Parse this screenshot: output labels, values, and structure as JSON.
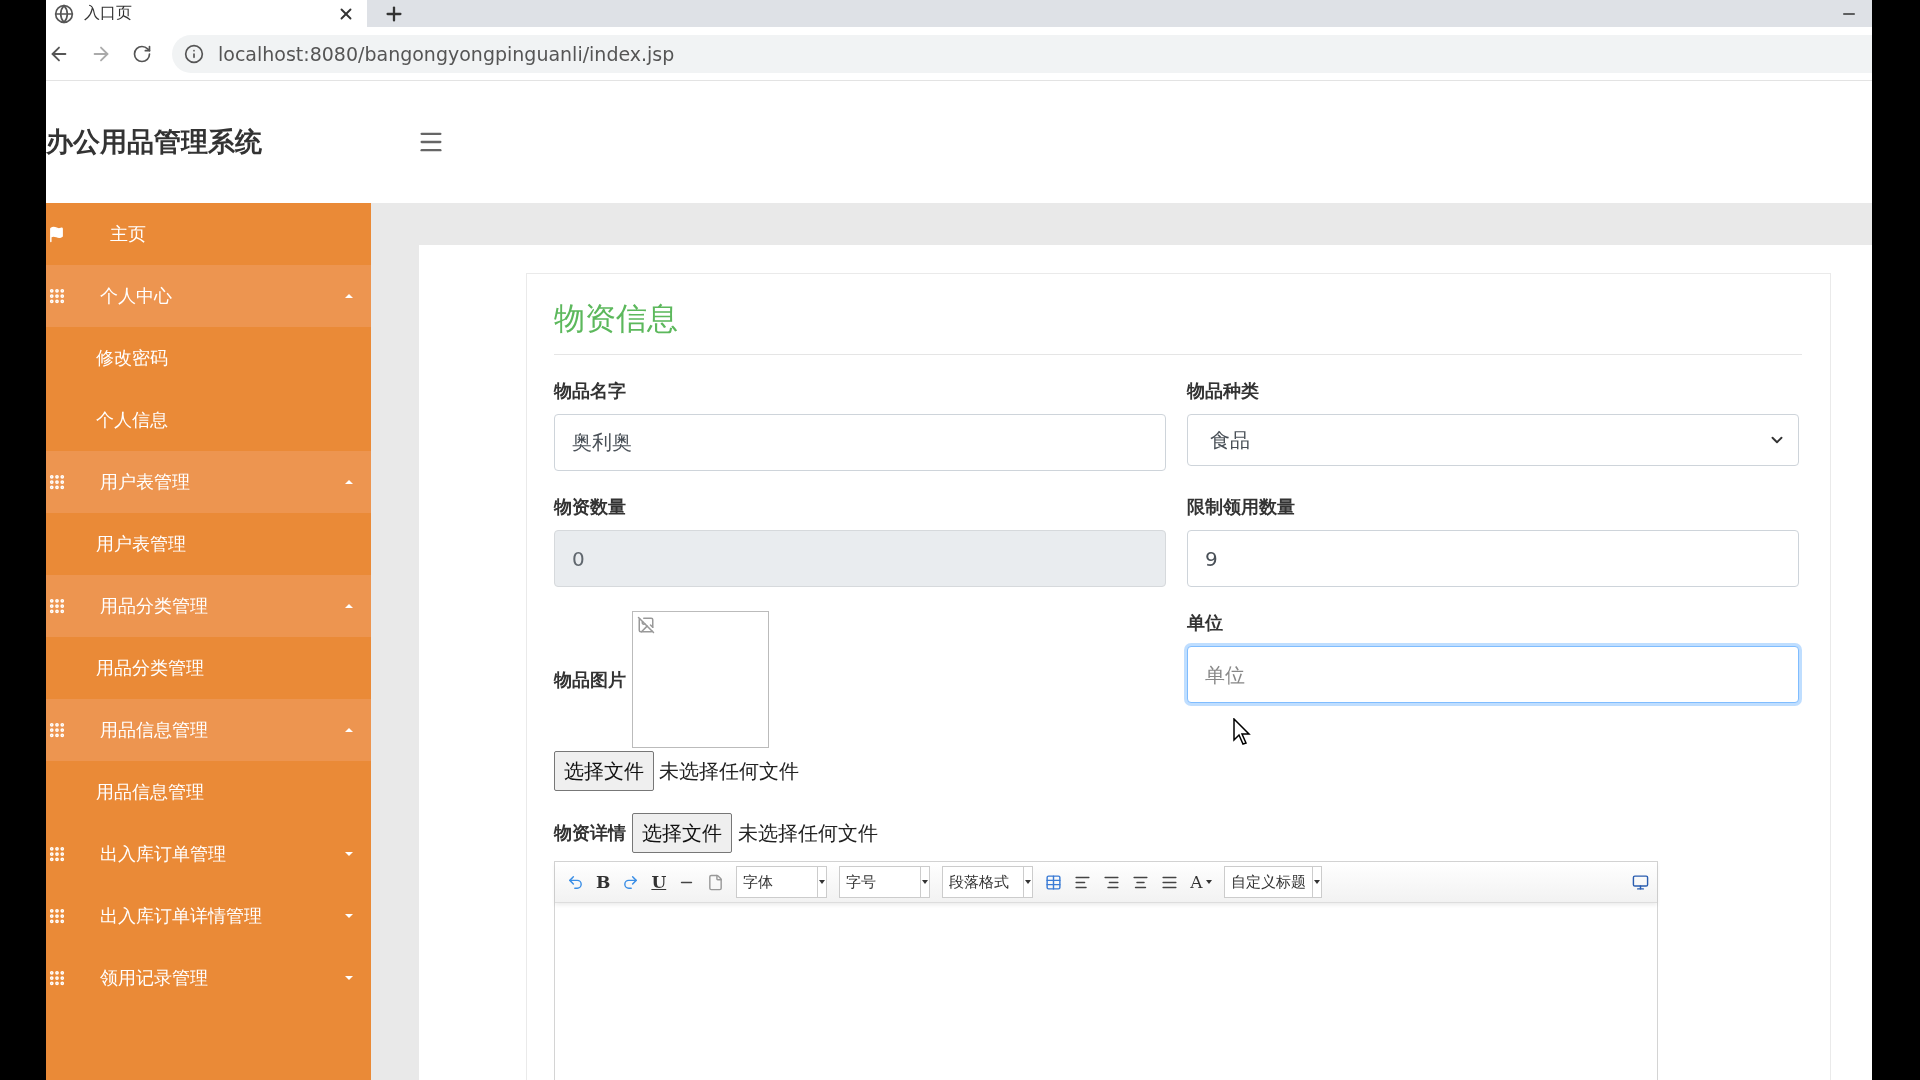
{
  "browser": {
    "tab_title": "入口页",
    "url": "localhost:8080/bangongyongpinguanli/index.jsp"
  },
  "header": {
    "title": "办公用品管理系统"
  },
  "sidebar": {
    "items": [
      {
        "kind": "link",
        "label": "主页"
      },
      {
        "kind": "group",
        "label": "个人中心",
        "expanded": true,
        "children": [
          {
            "label": "修改密码"
          },
          {
            "label": "个人信息"
          }
        ]
      },
      {
        "kind": "group",
        "label": "用户表管理",
        "expanded": true,
        "children": [
          {
            "label": "用户表管理"
          }
        ]
      },
      {
        "kind": "group",
        "label": "用品分类管理",
        "expanded": true,
        "children": [
          {
            "label": "用品分类管理"
          }
        ]
      },
      {
        "kind": "group",
        "label": "用品信息管理",
        "expanded": true,
        "children": [
          {
            "label": "用品信息管理"
          }
        ]
      },
      {
        "kind": "group",
        "label": "出入库订单管理",
        "expanded": false
      },
      {
        "kind": "group",
        "label": "出入库订单详情管理",
        "expanded": false
      },
      {
        "kind": "group",
        "label": "领用记录管理",
        "expanded": false
      }
    ]
  },
  "form": {
    "title": "物资信息",
    "fields": [
      {
        "kind": "text",
        "label": "物品名字",
        "value": "奥利奥",
        "disabled": false,
        "focused": false
      },
      {
        "kind": "select",
        "label": "物品种类",
        "value": "食品"
      },
      {
        "kind": "text",
        "label": "物资数量",
        "value": "0",
        "disabled": true,
        "focused": false
      },
      {
        "kind": "text",
        "label": "限制领用数量",
        "value": "9",
        "disabled": false,
        "focused": false
      },
      {
        "kind": "text",
        "label": "单位",
        "placeholder": "单位",
        "disabled": false,
        "focused": true
      }
    ],
    "image_field": {
      "label": "物品图片",
      "button": "选择文件",
      "status": "未选择任何文件"
    },
    "details": {
      "label": "物资详情",
      "button": "选择文件",
      "status": "未选择任何文件"
    },
    "toolbar": [
      {
        "kind": "undo"
      },
      {
        "kind": "bold",
        "label": "B"
      },
      {
        "kind": "redo"
      },
      {
        "kind": "underline",
        "label": "U"
      },
      {
        "kind": "rule"
      },
      {
        "kind": "page"
      },
      {
        "kind": "dropdown",
        "label": "字体"
      },
      {
        "kind": "dropdown",
        "label": "字号"
      },
      {
        "kind": "dropdown",
        "label": "段落格式"
      },
      {
        "kind": "table"
      },
      {
        "kind": "align-left"
      },
      {
        "kind": "align-right"
      },
      {
        "kind": "align-center"
      },
      {
        "kind": "justify"
      },
      {
        "kind": "color",
        "label": "A"
      },
      {
        "kind": "dropdown",
        "label": "自定义标题"
      },
      {
        "kind": "fullscreen"
      }
    ]
  }
}
